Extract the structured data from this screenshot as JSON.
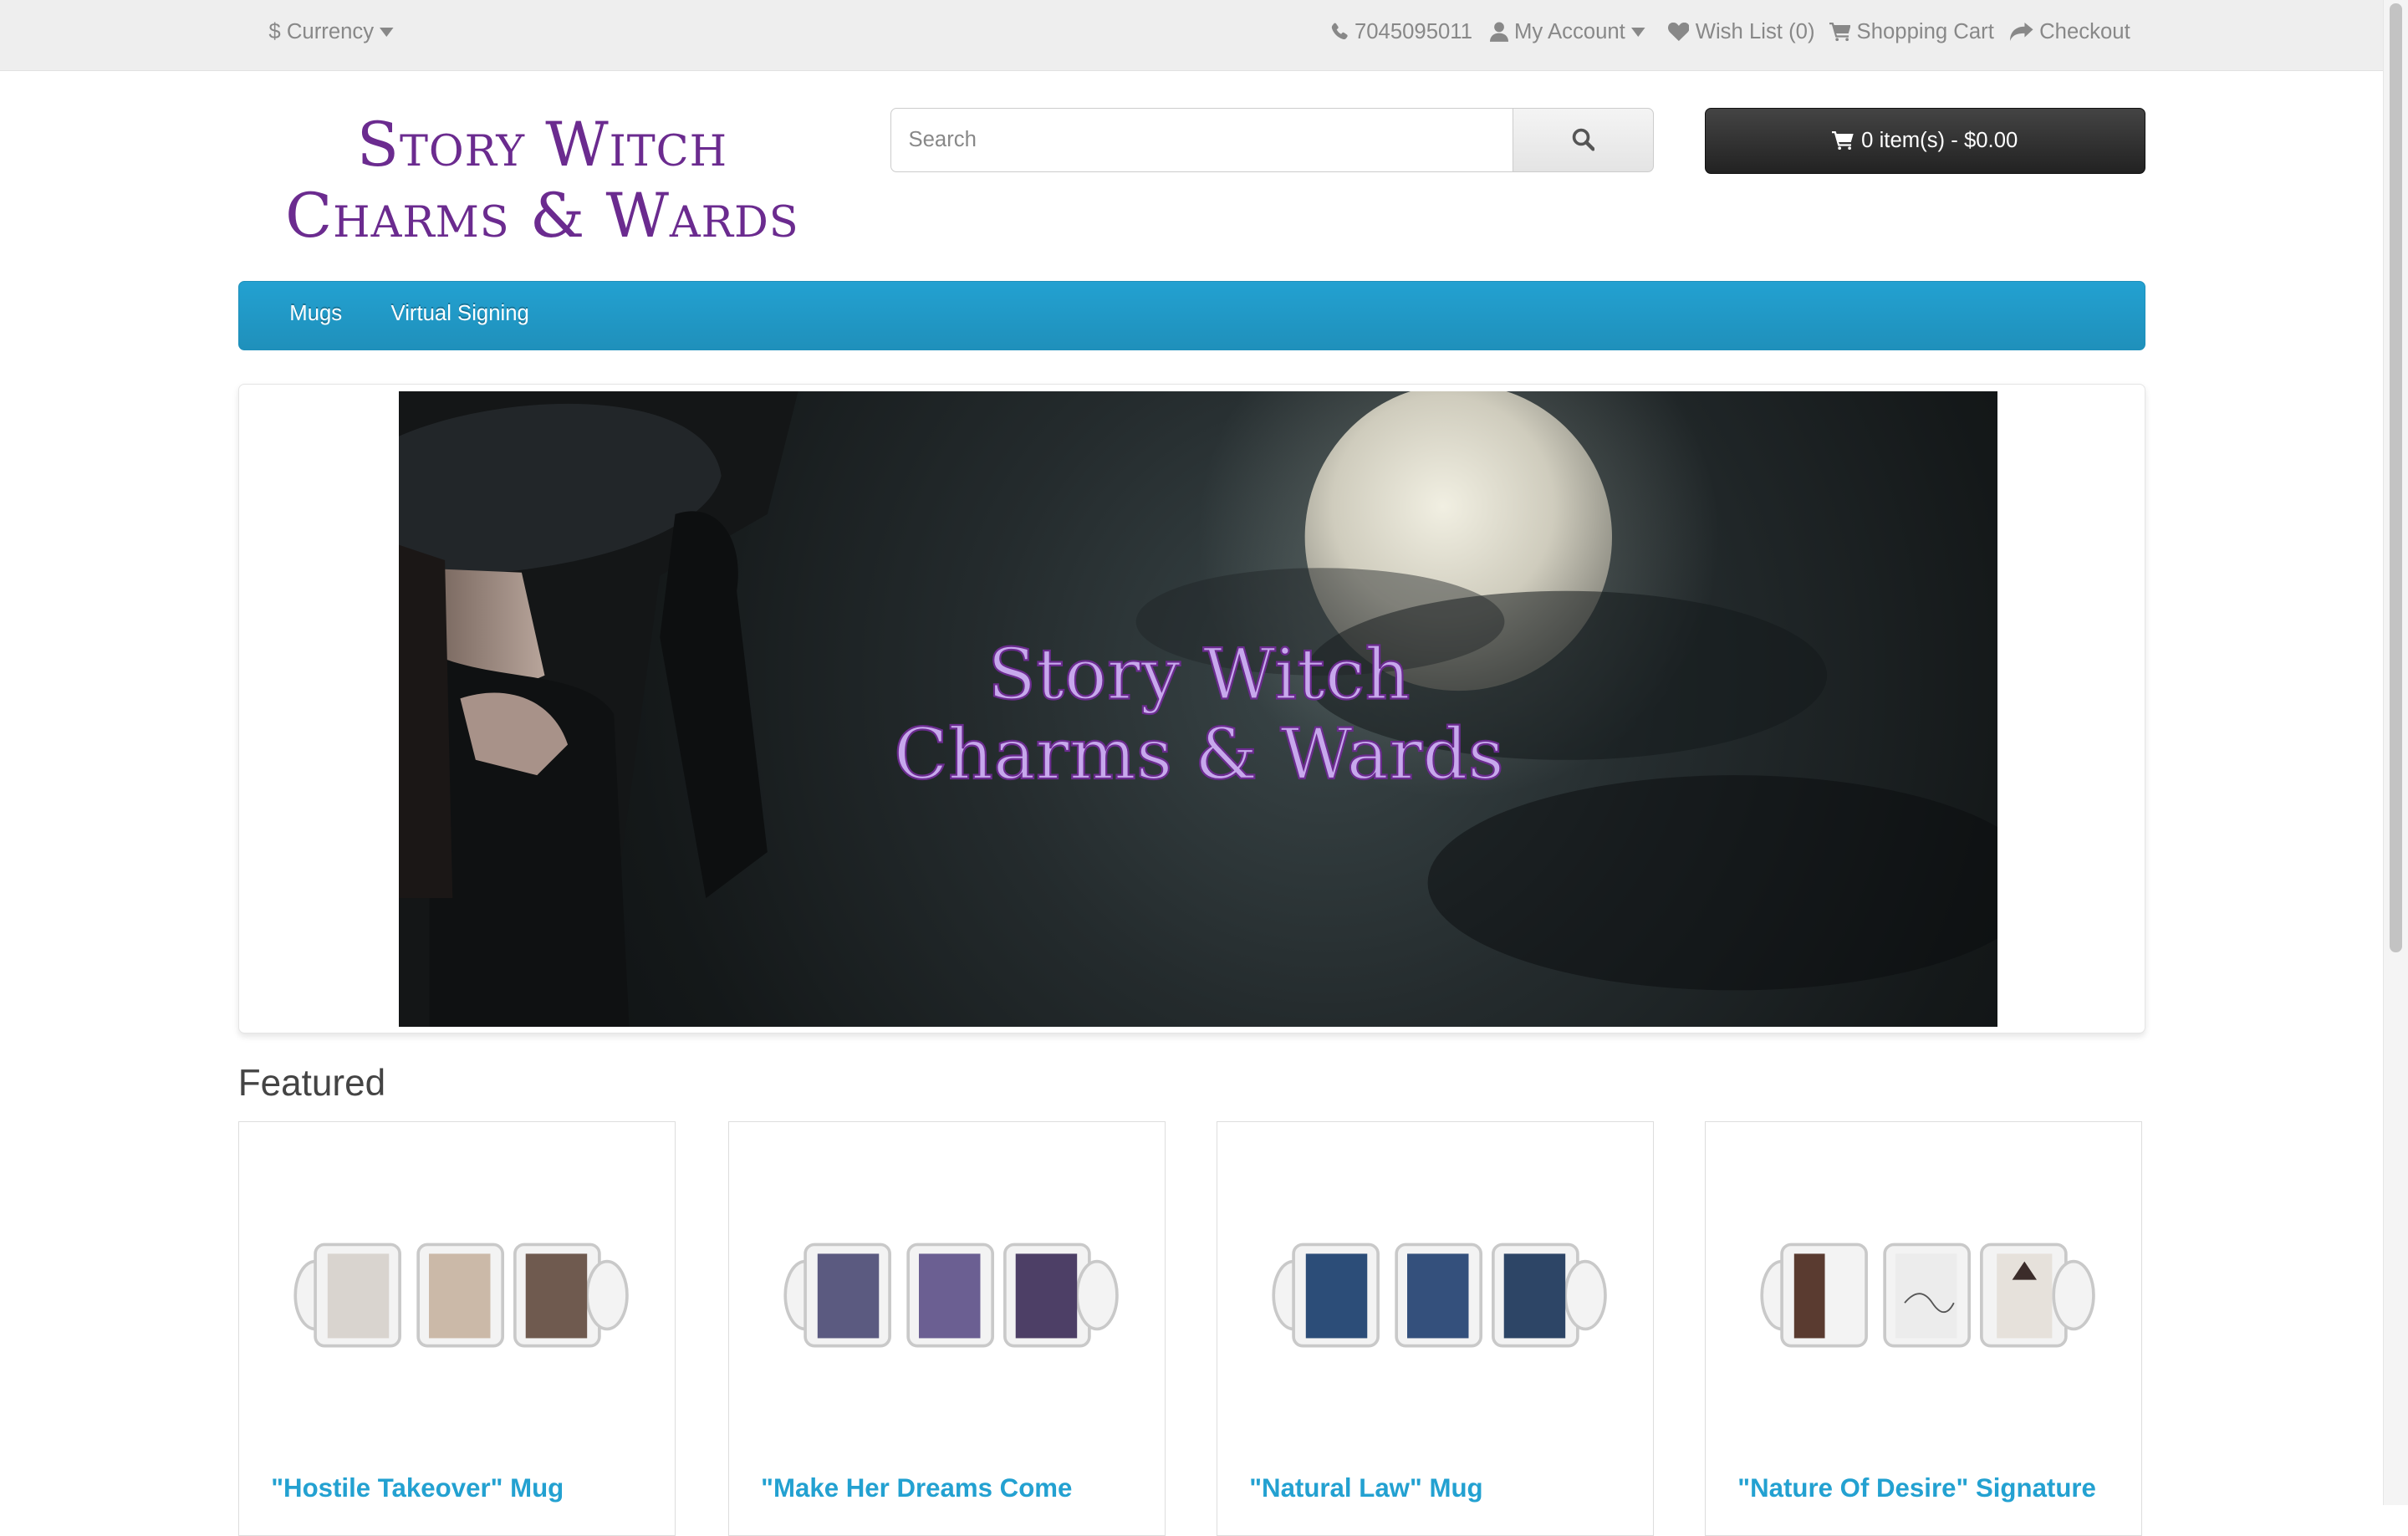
{
  "topbar": {
    "currency": "$ Currency",
    "phone": "7045095011",
    "my_account": "My Account",
    "wish_list": "Wish List (0)",
    "shopping_cart": "Shopping Cart",
    "checkout": "Checkout"
  },
  "header": {
    "logo_line1": "Story Witch",
    "logo_line2": "Charms & Wards",
    "search_placeholder": "Search",
    "cart_label": "0 item(s) - $0.00"
  },
  "menu": {
    "items": [
      {
        "label": "Mugs"
      },
      {
        "label": "Virtual Signing"
      }
    ]
  },
  "banner": {
    "title_line1": "Story Witch",
    "title_line2": "Charms & Wards"
  },
  "featured": {
    "heading": "Featured",
    "products": [
      {
        "name": "\"Hostile Takeover\" Mug"
      },
      {
        "name": "\"Make Her Dreams Come"
      },
      {
        "name": "\"Natural Law\" Mug"
      },
      {
        "name": "\"Nature Of Desire\" Signature"
      }
    ]
  },
  "colors": {
    "brand_purple": "#6b2b8f",
    "menu_blue": "#1f90bb",
    "link_blue": "#23a1d1",
    "cart_dark": "#333333"
  }
}
